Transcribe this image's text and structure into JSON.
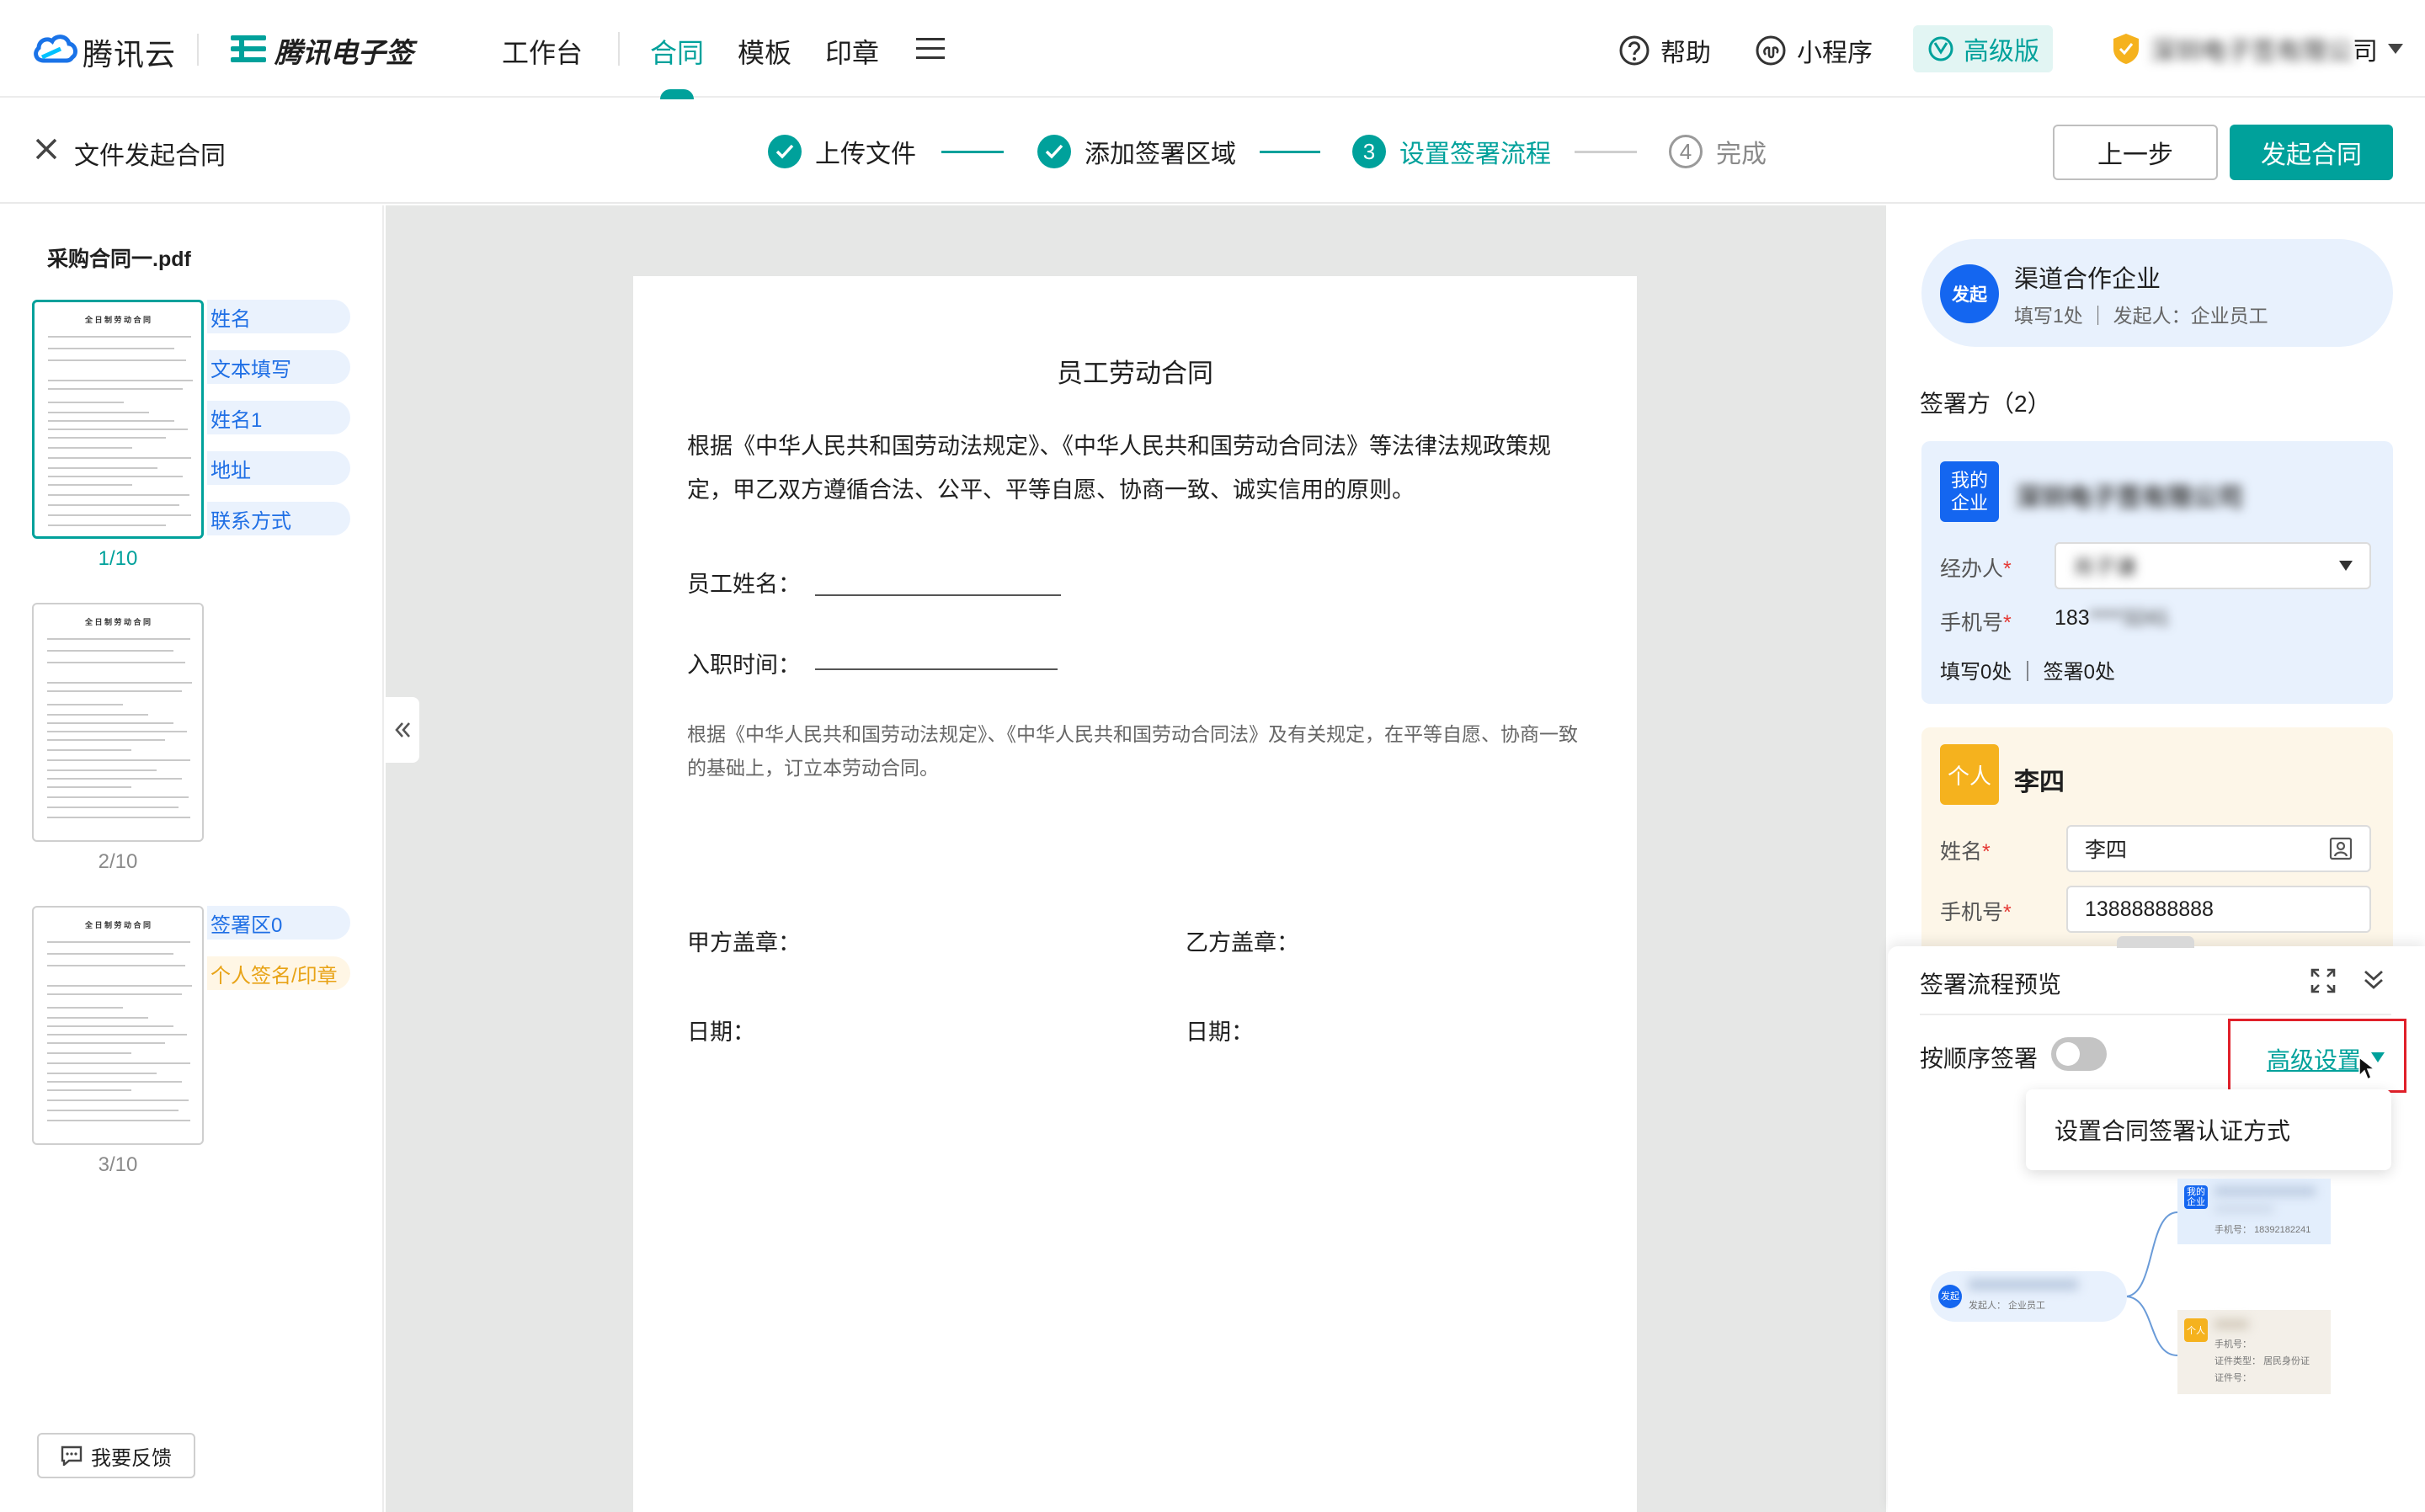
{
  "header": {
    "brand_cloud": "腾讯云",
    "brand_esign": "腾讯电子签",
    "nav": [
      {
        "label": "工作台"
      },
      {
        "label": "合同"
      },
      {
        "label": "模板"
      },
      {
        "label": "印章"
      }
    ],
    "help": "帮助",
    "miniprogram": "小程序",
    "vip": "高级版",
    "company_suffix": "司",
    "company_blurred": "深圳电子签有限公"
  },
  "stepbar": {
    "title": "文件发起合同",
    "steps": [
      {
        "num": "1",
        "label": "上传文件",
        "state": "done"
      },
      {
        "num": "2",
        "label": "添加签署区域",
        "state": "done"
      },
      {
        "num": "3",
        "label": "设置签署流程",
        "state": "current"
      },
      {
        "num": "4",
        "label": "完成",
        "state": "todo"
      }
    ],
    "prev": "上一步",
    "start": "发起合同"
  },
  "leftpanel": {
    "file_name": "采购合同一.pdf",
    "thumb_title": "全 日 制 劳 动 合 同",
    "pages": [
      {
        "label": "1/10",
        "fields": [
          "姓名",
          "文本填写",
          "姓名1",
          "地址",
          "联系方式"
        ]
      },
      {
        "label": "2/10",
        "fields": []
      },
      {
        "label": "3/10",
        "fields": [
          "签署区0",
          "个人签名/印章"
        ]
      }
    ],
    "feedback": "我要反馈"
  },
  "document": {
    "title": "员工劳动合同",
    "para1": "根据《中华人民共和国劳动法规定》、《中华人民共和国劳动合同法》等法律法规政策规定，甲乙双方遵循合法、公平、平等自愿、协商一致、诚实信用的原则。",
    "field_name": "员工姓名：",
    "field_date": "入职时间：",
    "para2": "根据《中华人民共和国劳动法规定》、《中华人民共和国劳动合同法》及有关规定，在平等自愿、协商一致的基础上，订立本劳动合同。",
    "partyA": "甲方盖章：",
    "partyB": "乙方盖章：",
    "dateA": "日期：",
    "dateB": "日期："
  },
  "rightpanel": {
    "initiator": {
      "badge": "发起",
      "name": "渠道合作企业",
      "meta": "填写1处 ｜ 发起人：企业员工"
    },
    "signers_title": "签署方（2）",
    "enterprise": {
      "badge": "我的\n企业",
      "name_blurred": "深圳电子签有限公司",
      "handler_label": "经办人",
      "handler_blurred": "肖子谦",
      "phone_label": "手机号",
      "phone_prefix": "183",
      "phone_blurred": "****3241",
      "counts": "填写0处 ｜ 签署0处"
    },
    "personal": {
      "badge": "个人",
      "name": "李四",
      "name_label": "姓名",
      "name_value": "李四",
      "phone_label": "手机号",
      "phone_value": "13888888888"
    },
    "preview": {
      "title": "签署流程预览",
      "order_label": "按顺序签署",
      "order_on": false,
      "advanced": "高级设置",
      "menu_item": "设置合同签署认证方式",
      "mini": {
        "init_badge": "发起",
        "init_meta": "发起人：  企业员工",
        "ent_badge": "我的企业",
        "ent_phone_label": "手机号：",
        "ent_phone": "18392182241",
        "per_badge": "个人",
        "per_phone_label": "手机号：",
        "per_idtype_label": "证件类型：",
        "per_idtype": "居民身份证",
        "per_idno_label": "证件号："
      }
    }
  },
  "colors": {
    "accent": "#00a19b",
    "blue": "#1466f0",
    "yellow": "#f5b21e",
    "highlight": "#e0202a"
  }
}
